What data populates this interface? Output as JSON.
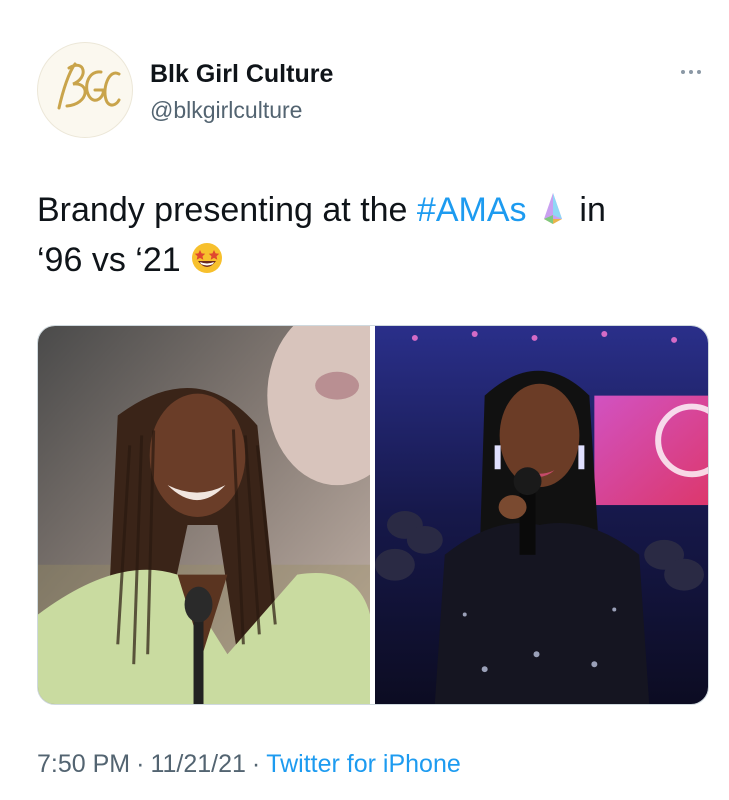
{
  "account": {
    "name": "Blk Girl Culture",
    "handle": "@blkgirlculture",
    "avatar_logo_text": "BGC"
  },
  "tweet": {
    "text_part1": "Brandy presenting at the ",
    "hashtag": "#AMAs",
    "text_part2": " in",
    "text_line2": "‘96 vs ‘21 ",
    "emoji_1": "award-trophy-emoji",
    "emoji_2": "star-struck-emoji"
  },
  "media": {
    "photos": [
      {
        "label": "1996 photo"
      },
      {
        "label": "2021 photo"
      }
    ]
  },
  "meta": {
    "time": "7:50 PM",
    "dot": "·",
    "date": "11/21/21",
    "source": "Twitter for iPhone"
  },
  "colors": {
    "link": "#1d9bf0",
    "secondary_text": "#536471",
    "primary_text": "#0f1419"
  }
}
